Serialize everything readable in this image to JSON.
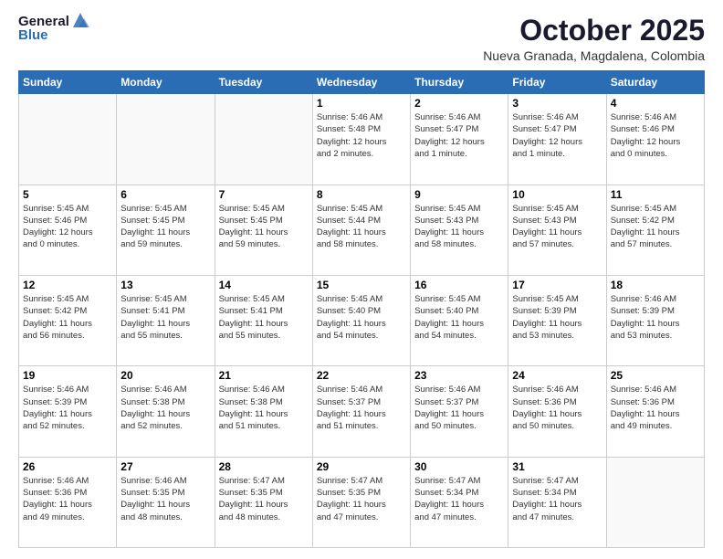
{
  "header": {
    "logo_line1": "General",
    "logo_line2": "Blue",
    "month_title": "October 2025",
    "location": "Nueva Granada, Magdalena, Colombia"
  },
  "days_of_week": [
    "Sunday",
    "Monday",
    "Tuesday",
    "Wednesday",
    "Thursday",
    "Friday",
    "Saturday"
  ],
  "weeks": [
    [
      {
        "day": "",
        "info": ""
      },
      {
        "day": "",
        "info": ""
      },
      {
        "day": "",
        "info": ""
      },
      {
        "day": "1",
        "info": "Sunrise: 5:46 AM\nSunset: 5:48 PM\nDaylight: 12 hours\nand 2 minutes."
      },
      {
        "day": "2",
        "info": "Sunrise: 5:46 AM\nSunset: 5:47 PM\nDaylight: 12 hours\nand 1 minute."
      },
      {
        "day": "3",
        "info": "Sunrise: 5:46 AM\nSunset: 5:47 PM\nDaylight: 12 hours\nand 1 minute."
      },
      {
        "day": "4",
        "info": "Sunrise: 5:46 AM\nSunset: 5:46 PM\nDaylight: 12 hours\nand 0 minutes."
      }
    ],
    [
      {
        "day": "5",
        "info": "Sunrise: 5:45 AM\nSunset: 5:46 PM\nDaylight: 12 hours\nand 0 minutes."
      },
      {
        "day": "6",
        "info": "Sunrise: 5:45 AM\nSunset: 5:45 PM\nDaylight: 11 hours\nand 59 minutes."
      },
      {
        "day": "7",
        "info": "Sunrise: 5:45 AM\nSunset: 5:45 PM\nDaylight: 11 hours\nand 59 minutes."
      },
      {
        "day": "8",
        "info": "Sunrise: 5:45 AM\nSunset: 5:44 PM\nDaylight: 11 hours\nand 58 minutes."
      },
      {
        "day": "9",
        "info": "Sunrise: 5:45 AM\nSunset: 5:43 PM\nDaylight: 11 hours\nand 58 minutes."
      },
      {
        "day": "10",
        "info": "Sunrise: 5:45 AM\nSunset: 5:43 PM\nDaylight: 11 hours\nand 57 minutes."
      },
      {
        "day": "11",
        "info": "Sunrise: 5:45 AM\nSunset: 5:42 PM\nDaylight: 11 hours\nand 57 minutes."
      }
    ],
    [
      {
        "day": "12",
        "info": "Sunrise: 5:45 AM\nSunset: 5:42 PM\nDaylight: 11 hours\nand 56 minutes."
      },
      {
        "day": "13",
        "info": "Sunrise: 5:45 AM\nSunset: 5:41 PM\nDaylight: 11 hours\nand 55 minutes."
      },
      {
        "day": "14",
        "info": "Sunrise: 5:45 AM\nSunset: 5:41 PM\nDaylight: 11 hours\nand 55 minutes."
      },
      {
        "day": "15",
        "info": "Sunrise: 5:45 AM\nSunset: 5:40 PM\nDaylight: 11 hours\nand 54 minutes."
      },
      {
        "day": "16",
        "info": "Sunrise: 5:45 AM\nSunset: 5:40 PM\nDaylight: 11 hours\nand 54 minutes."
      },
      {
        "day": "17",
        "info": "Sunrise: 5:45 AM\nSunset: 5:39 PM\nDaylight: 11 hours\nand 53 minutes."
      },
      {
        "day": "18",
        "info": "Sunrise: 5:46 AM\nSunset: 5:39 PM\nDaylight: 11 hours\nand 53 minutes."
      }
    ],
    [
      {
        "day": "19",
        "info": "Sunrise: 5:46 AM\nSunset: 5:39 PM\nDaylight: 11 hours\nand 52 minutes."
      },
      {
        "day": "20",
        "info": "Sunrise: 5:46 AM\nSunset: 5:38 PM\nDaylight: 11 hours\nand 52 minutes."
      },
      {
        "day": "21",
        "info": "Sunrise: 5:46 AM\nSunset: 5:38 PM\nDaylight: 11 hours\nand 51 minutes."
      },
      {
        "day": "22",
        "info": "Sunrise: 5:46 AM\nSunset: 5:37 PM\nDaylight: 11 hours\nand 51 minutes."
      },
      {
        "day": "23",
        "info": "Sunrise: 5:46 AM\nSunset: 5:37 PM\nDaylight: 11 hours\nand 50 minutes."
      },
      {
        "day": "24",
        "info": "Sunrise: 5:46 AM\nSunset: 5:36 PM\nDaylight: 11 hours\nand 50 minutes."
      },
      {
        "day": "25",
        "info": "Sunrise: 5:46 AM\nSunset: 5:36 PM\nDaylight: 11 hours\nand 49 minutes."
      }
    ],
    [
      {
        "day": "26",
        "info": "Sunrise: 5:46 AM\nSunset: 5:36 PM\nDaylight: 11 hours\nand 49 minutes."
      },
      {
        "day": "27",
        "info": "Sunrise: 5:46 AM\nSunset: 5:35 PM\nDaylight: 11 hours\nand 48 minutes."
      },
      {
        "day": "28",
        "info": "Sunrise: 5:47 AM\nSunset: 5:35 PM\nDaylight: 11 hours\nand 48 minutes."
      },
      {
        "day": "29",
        "info": "Sunrise: 5:47 AM\nSunset: 5:35 PM\nDaylight: 11 hours\nand 47 minutes."
      },
      {
        "day": "30",
        "info": "Sunrise: 5:47 AM\nSunset: 5:34 PM\nDaylight: 11 hours\nand 47 minutes."
      },
      {
        "day": "31",
        "info": "Sunrise: 5:47 AM\nSunset: 5:34 PM\nDaylight: 11 hours\nand 47 minutes."
      },
      {
        "day": "",
        "info": ""
      }
    ]
  ]
}
